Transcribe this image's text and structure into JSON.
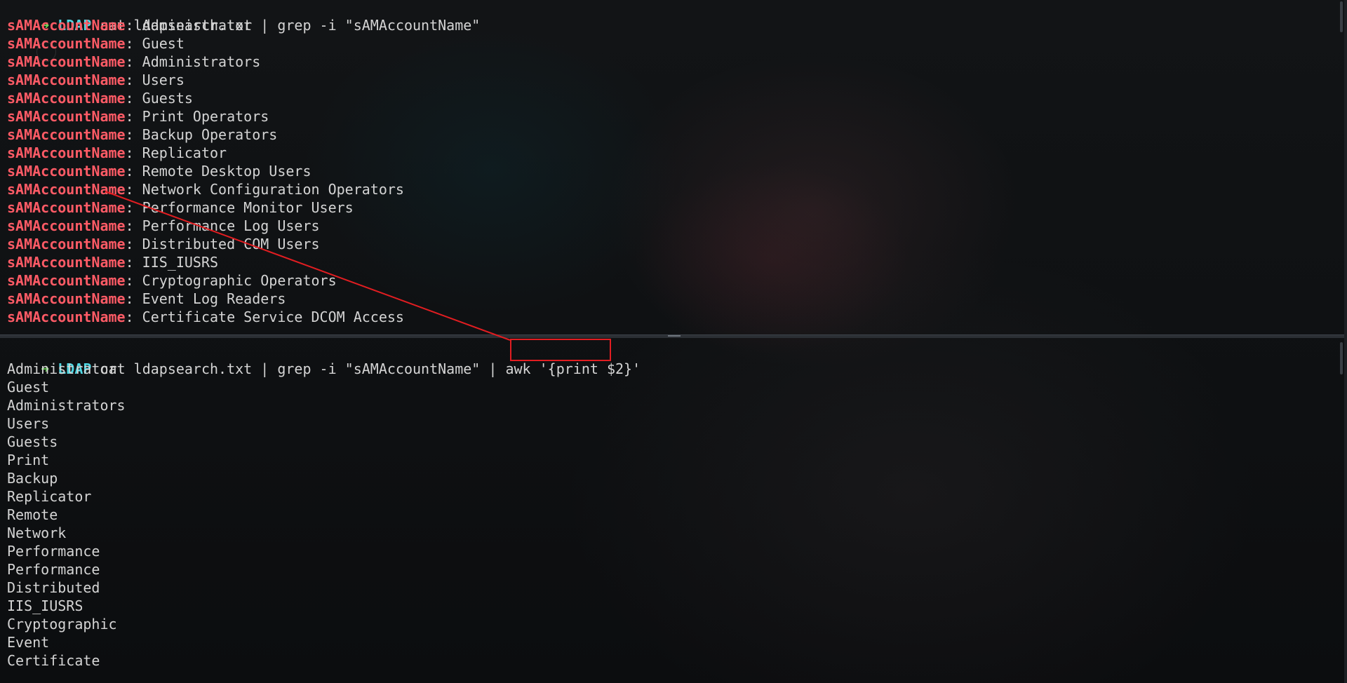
{
  "top_pane": {
    "prompt": {
      "arrow": "➜",
      "dir": "LDAP",
      "command": "cat ldapsearch.txt | grep -i \"sAMAccountName\""
    },
    "attribute": "sAMAccountName",
    "entries": [
      "Administrator",
      "Guest",
      "Administrators",
      "Users",
      "Guests",
      "Print Operators",
      "Backup Operators",
      "Replicator",
      "Remote Desktop Users",
      "Network Configuration Operators",
      "Performance Monitor Users",
      "Performance Log Users",
      "Distributed COM Users",
      "IIS_IUSRS",
      "Cryptographic Operators",
      "Event Log Readers",
      "Certificate Service DCOM Access"
    ]
  },
  "bottom_pane": {
    "prompt": {
      "arrow": "➜",
      "dir": "LDAP",
      "command": "cat ldapsearch.txt | grep -i \"sAMAccountName\" | awk ",
      "awk_arg": "'{print $2}'"
    },
    "output": [
      "Administrator",
      "Guest",
      "Administrators",
      "Users",
      "Guests",
      "Print",
      "Backup",
      "Replicator",
      "Remote",
      "Network",
      "Performance",
      "Performance",
      "Distributed",
      "IIS_IUSRS",
      "Cryptographic",
      "Event",
      "Certificate"
    ]
  },
  "annotation": {
    "color": "#e11d21"
  },
  "colors": {
    "prompt_arrow": "#6bdc57",
    "prompt_dir": "#4fd6e2",
    "match_highlight": "#ff5b66",
    "text": "#d4d4d4"
  }
}
